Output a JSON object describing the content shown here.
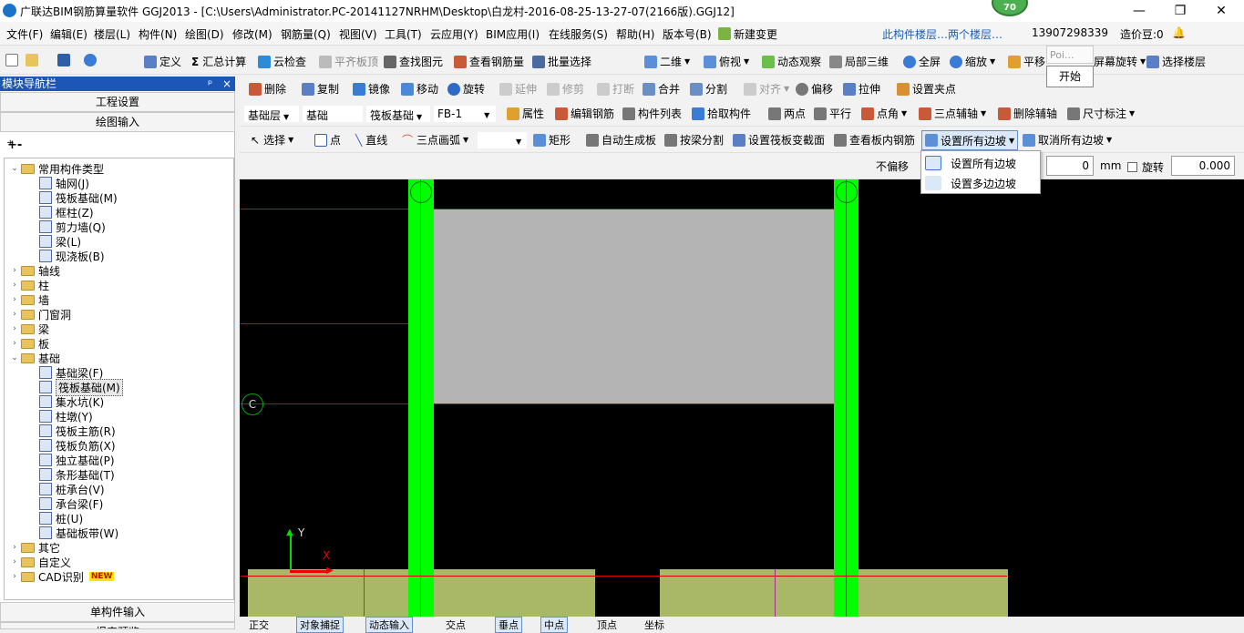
{
  "window": {
    "title": "广联达BIM钢筋算量软件 GGJ2013 - [C:\\Users\\Administrator.PC-20141127NRHM\\Desktop\\白龙村-2016-08-25-13-27-07(2166版).GGJ12]",
    "badge": "70",
    "minimize": "—",
    "restore": "❐",
    "close": "✕"
  },
  "menu": {
    "items": [
      "文件(F)",
      "编辑(E)",
      "楼层(L)",
      "构件(N)",
      "绘图(D)",
      "修改(M)",
      "钢筋量(Q)",
      "视图(V)",
      "工具(T)",
      "云应用(Y)",
      "BIM应用(I)",
      "在线服务(S)",
      "帮助(H)",
      "版本号(B)",
      "新建变更"
    ],
    "notice": "此构件楼层…两个楼层…",
    "phone": "13907298339",
    "beans": "造价豆:0"
  },
  "toolbar1": {
    "items": [
      "定义",
      "汇总计算",
      "云检查",
      "平齐板顶",
      "查找图元",
      "查看钢筋量",
      "批量选择",
      "二维",
      "俯视",
      "动态观察",
      "局部三维",
      "全屏",
      "缩放",
      "平移",
      "屏幕旋转",
      "选择楼层"
    ]
  },
  "toolbar2": {
    "items": [
      "删除",
      "复制",
      "镜像",
      "移动",
      "旋转",
      "延伸",
      "修剪",
      "打断",
      "合并",
      "分割",
      "对齐",
      "偏移",
      "拉伸",
      "设置夹点"
    ]
  },
  "toolbar3": {
    "floor": "基础层",
    "category": "基础",
    "type": "筏板基础",
    "component": "FB-1",
    "items": [
      "属性",
      "编辑钢筋",
      "构件列表",
      "拾取构件",
      "两点",
      "平行",
      "点角",
      "三点辅轴",
      "删除辅轴",
      "尺寸标注"
    ]
  },
  "toolbar4": {
    "items": [
      "选择",
      "点",
      "直线",
      "三点画弧",
      "矩形",
      "自动生成板",
      "按梁分割",
      "设置筏板变截面",
      "查看板内钢筋",
      "设置所有边坡",
      "取消所有边坡"
    ]
  },
  "toolbar5": {
    "no_offset": "不偏移",
    "x_value": "0",
    "unit": "mm",
    "rotate_label": "旋转",
    "rotate_value": "0.000"
  },
  "dropdown": {
    "items": [
      "设置所有边坡",
      "设置多边边坡"
    ]
  },
  "popup": {
    "start": "开始",
    "poi": "Poi..."
  },
  "leftpanel": {
    "title": "模块导航栏",
    "pin": "ᵖ",
    "close": "×",
    "btn_project": "工程设置",
    "btn_draw": "绘图输入",
    "btn_single": "单构件输入",
    "btn_report": "报表预览",
    "tree": [
      {
        "label": "常用构件类型",
        "level": 0,
        "folder": true,
        "open": true
      },
      {
        "label": "轴网(J)",
        "level": 1
      },
      {
        "label": "筏板基础(M)",
        "level": 1
      },
      {
        "label": "框柱(Z)",
        "level": 1
      },
      {
        "label": "剪力墙(Q)",
        "level": 1
      },
      {
        "label": "梁(L)",
        "level": 1
      },
      {
        "label": "现浇板(B)",
        "level": 1
      },
      {
        "label": "轴线",
        "level": 0,
        "folder": true
      },
      {
        "label": "柱",
        "level": 0,
        "folder": true
      },
      {
        "label": "墙",
        "level": 0,
        "folder": true
      },
      {
        "label": "门窗洞",
        "level": 0,
        "folder": true
      },
      {
        "label": "梁",
        "level": 0,
        "folder": true
      },
      {
        "label": "板",
        "level": 0,
        "folder": true
      },
      {
        "label": "基础",
        "level": 0,
        "folder": true,
        "open": true
      },
      {
        "label": "基础梁(F)",
        "level": 1
      },
      {
        "label": "筏板基础(M)",
        "level": 1,
        "selected": true
      },
      {
        "label": "集水坑(K)",
        "level": 1
      },
      {
        "label": "柱墩(Y)",
        "level": 1
      },
      {
        "label": "筏板主筋(R)",
        "level": 1
      },
      {
        "label": "筏板负筋(X)",
        "level": 1
      },
      {
        "label": "独立基础(P)",
        "level": 1
      },
      {
        "label": "条形基础(T)",
        "level": 1
      },
      {
        "label": "桩承台(V)",
        "level": 1
      },
      {
        "label": "承台梁(F)",
        "level": 1
      },
      {
        "label": "桩(U)",
        "level": 1
      },
      {
        "label": "基础板带(W)",
        "level": 1
      },
      {
        "label": "其它",
        "level": 0,
        "folder": true
      },
      {
        "label": "自定义",
        "level": 0,
        "folder": true
      },
      {
        "label": "CAD识别",
        "level": 0,
        "folder": true,
        "new": "NEW"
      }
    ]
  },
  "canvas": {
    "axis_label_c": "C",
    "axis_y": "Y",
    "axis_x": "X"
  },
  "statusbar": {
    "items": [
      "正交",
      "对象捕捉",
      "动态输入",
      "交点",
      "垂点",
      "中点",
      "顶点",
      "坐标"
    ]
  },
  "colors": {
    "green_column": "#00ff00",
    "slab_gray": "#b4b4b4",
    "base_olive": "#a8b866",
    "red_line": "#d40000"
  }
}
